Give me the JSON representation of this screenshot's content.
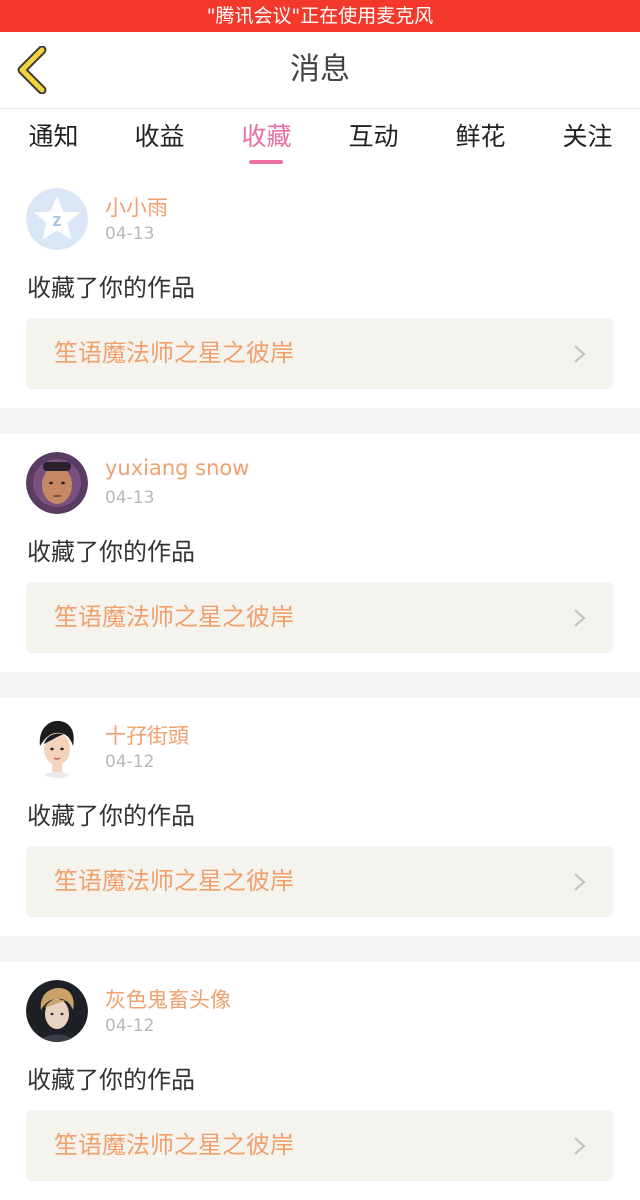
{
  "status_bar": {
    "text": "\"腾讯会议\"正在使用麦克风"
  },
  "header": {
    "title": "消息"
  },
  "tabs": [
    {
      "label": "通知",
      "active": false
    },
    {
      "label": "收益",
      "active": false
    },
    {
      "label": "收藏",
      "active": true
    },
    {
      "label": "互动",
      "active": false
    },
    {
      "label": "鲜花",
      "active": false
    },
    {
      "label": "关注",
      "active": false
    }
  ],
  "items": [
    {
      "username": "小小雨",
      "date": "04-13",
      "action": "收藏了你的作品",
      "work_title": "笙语魔法师之星之彼岸"
    },
    {
      "username": "yuxiang snow",
      "date": "04-13",
      "action": "收藏了你的作品",
      "work_title": "笙语魔法师之星之彼岸"
    },
    {
      "username": "十孖街頭",
      "date": "04-12",
      "action": "收藏了你的作品",
      "work_title": "笙语魔法师之星之彼岸"
    },
    {
      "username": "灰色鬼畜头像",
      "date": "04-12",
      "action": "收藏了你的作品",
      "work_title": "笙语魔法师之星之彼岸"
    }
  ],
  "colors": {
    "status_bar": "#f2392c",
    "accent_pink": "#ec6fa3",
    "username_orange": "#f0a06e",
    "back_arrow_yellow": "#f5d33a"
  }
}
